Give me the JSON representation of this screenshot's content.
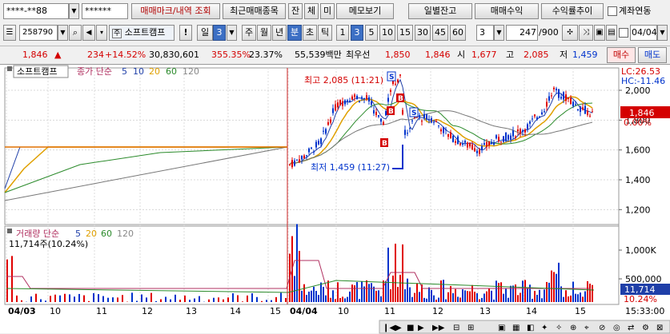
{
  "top": {
    "account": "****-**88",
    "password": "******",
    "buttons": [
      "매매마크/내역 조회",
      "최근매매종목",
      "잔",
      "체",
      "미",
      "메모보기",
      "일별잔고",
      "매매수익",
      "수익률추이"
    ],
    "account_link_label": "계좌연동"
  },
  "toolbar": {
    "code": "258790",
    "name": "소프트캠프",
    "period_unit": "일",
    "period_value": "3",
    "periods": [
      "주",
      "월",
      "년",
      "분",
      "초",
      "틱"
    ],
    "minutes": [
      "1",
      "3",
      "5",
      "10",
      "15",
      "30",
      "45",
      "60"
    ],
    "selected_minute": "3",
    "interval_select": "3",
    "count": "247",
    "count_total": "/900",
    "date": "04/04",
    "selected_period": "분"
  },
  "quote": {
    "price": "1,846",
    "change_arrow": "▲",
    "change": "234",
    "change_pct": "+14.52%",
    "volume": "30,830,601",
    "vol_ratio": "355.35%",
    "turnover": "23.37%",
    "amount": "55,539백만",
    "best_ask_label": "최우선",
    "best_ask": "1,850",
    "best_bid": "1,846",
    "open_label": "시",
    "open": "1,677",
    "high_label": "고",
    "high": "2,085",
    "low_label": "저",
    "low": "1,459",
    "buy_button": "매수",
    "sell_button": "매도"
  },
  "price_panel": {
    "legend_name": "소프트캠프",
    "legend_ma": "종가 단순",
    "ma_periods": [
      "5",
      "10",
      "20",
      "60",
      "120"
    ],
    "high_annotation": "최고 2,085 (11:21)",
    "low_annotation": "최저 1,459 (11:27)",
    "lc": "LC:26.53",
    "hc": "HC:-11.46",
    "current_price_tag": "1,846",
    "current_pct_tag": "0.00%",
    "yticks": [
      "2,000",
      "1,800",
      "1,600",
      "1,400",
      "1,200"
    ]
  },
  "volume_panel": {
    "legend": "거래량 단순",
    "ma_periods": [
      "5",
      "20",
      "60",
      "120"
    ],
    "value_label": "11,714주(10.24%)",
    "current_tag": "11,714",
    "current_pct_tag": "10.24%",
    "yticks": [
      "1,000K",
      "500,000"
    ]
  },
  "xaxis": {
    "labels": [
      "04/03",
      "10",
      "11",
      "12",
      "13",
      "14",
      "15",
      "04/04",
      "10",
      "11",
      "12",
      "13",
      "14",
      "15"
    ],
    "time": "15:33:00"
  },
  "colors": {
    "up": "#e00000",
    "down": "#0033cc",
    "ma5": "#1f3fa8",
    "ma10": "#e0a000",
    "ma20": "#2a8a2a",
    "ma60": "#777777",
    "ma120": "#b0b0b0",
    "cursor": "#cc2222"
  }
}
